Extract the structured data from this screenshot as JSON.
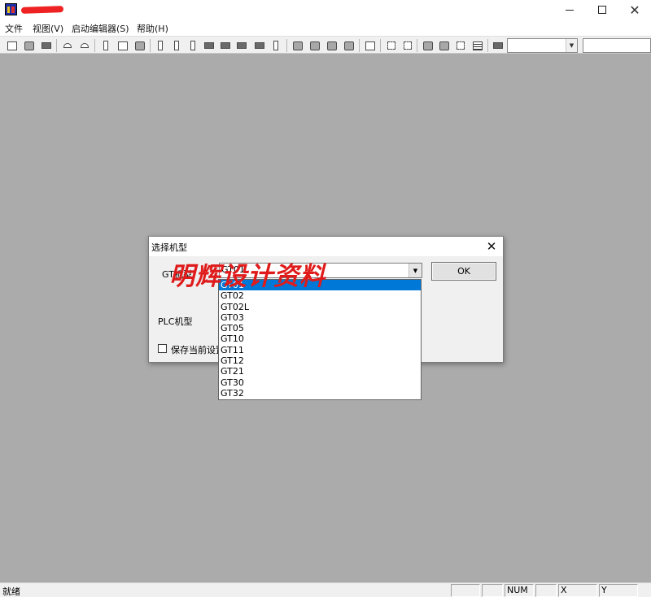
{
  "window": {
    "close_glyph": "✕"
  },
  "menu": {
    "items": [
      "文件",
      "视图(V)",
      "启动编辑器(S)",
      "帮助(H)"
    ]
  },
  "toolbar": {
    "icons": [
      "new-file-icon",
      "open-folder-icon",
      "save-icon",
      "undo-icon",
      "redo-icon",
      "cut-icon",
      "copy-icon",
      "paste-icon",
      "align-left-icon",
      "align-center-icon",
      "align-right-icon",
      "align-top-icon",
      "align-middle-icon",
      "align-bottom-icon",
      "distribute-horizontal-icon",
      "distribute-vertical-icon",
      "bring-front-icon",
      "send-back-icon",
      "bring-forward-icon",
      "send-backward-icon",
      "group-icon",
      "ungroup-icon",
      "property-icon",
      "layer-icon",
      "settings-icon",
      "snap-icon",
      "grid-icon",
      "palette-icon"
    ],
    "combo1_value": "",
    "combo2_value": ""
  },
  "status": {
    "ready_text": "就绪",
    "num": "NUM",
    "x": "X",
    "y": "Y"
  },
  "dialog": {
    "title": "选择机型",
    "gt_label": "GT机型",
    "combo_value": "GT01",
    "ok_label": "OK",
    "plc_label": "PLC机型",
    "save_label": "保存当前设置",
    "options": [
      "GT01",
      "GT02",
      "GT02L",
      "GT03",
      "GT05",
      "GT10",
      "GT11",
      "GT12",
      "GT21",
      "GT30",
      "GT32"
    ],
    "selected_index": 0
  },
  "watermark": {
    "text": "明辉设计资料"
  },
  "colors": {
    "workspace": "#ababab",
    "selection": "#0078d7",
    "watermark": "#e01b1b"
  }
}
